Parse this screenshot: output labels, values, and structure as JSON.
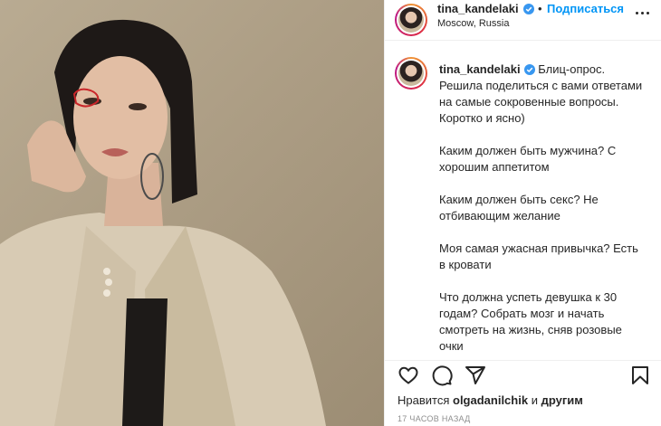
{
  "post": {
    "author": {
      "username": "tina_kandelaki",
      "verified": true,
      "location": "Moscow, Russia",
      "avatar_icon": "profile-avatar"
    },
    "header": {
      "separator": "•",
      "follow_label": "Подписаться"
    },
    "photo": {
      "description_icon": "portrait-photo"
    },
    "caption": {
      "username": "tina_kandelaki",
      "text": "Блиц-опрос. Решила поделиться с вами ответами на самые сокровенные вопросы. Коротко и ясно)\n\nКаким должен быть мужчина? С хорошим аппетитом\n\nКаким должен быть секс? Не отбивающим желание\n\nМоя самая ужасная привычка? Есть в кровати\n\nЧто должна успеть девушка к 30 годам? Собрать мозг и начать смотреть на жизнь, сняв розовые очки\n\nС…"
    },
    "likes": {
      "prefix": "Нравится",
      "user": "olgadanilchik",
      "conjunction": "и",
      "others": "другим"
    },
    "timestamp": "17 часов назад",
    "colors": {
      "accent": "#0095f6",
      "text": "#262626",
      "muted": "#8e8e8e",
      "border": "#efefef"
    },
    "icons": [
      "heart-icon",
      "comment-icon",
      "share-icon",
      "bookmark-icon",
      "more-icon",
      "verified-icon"
    ]
  }
}
